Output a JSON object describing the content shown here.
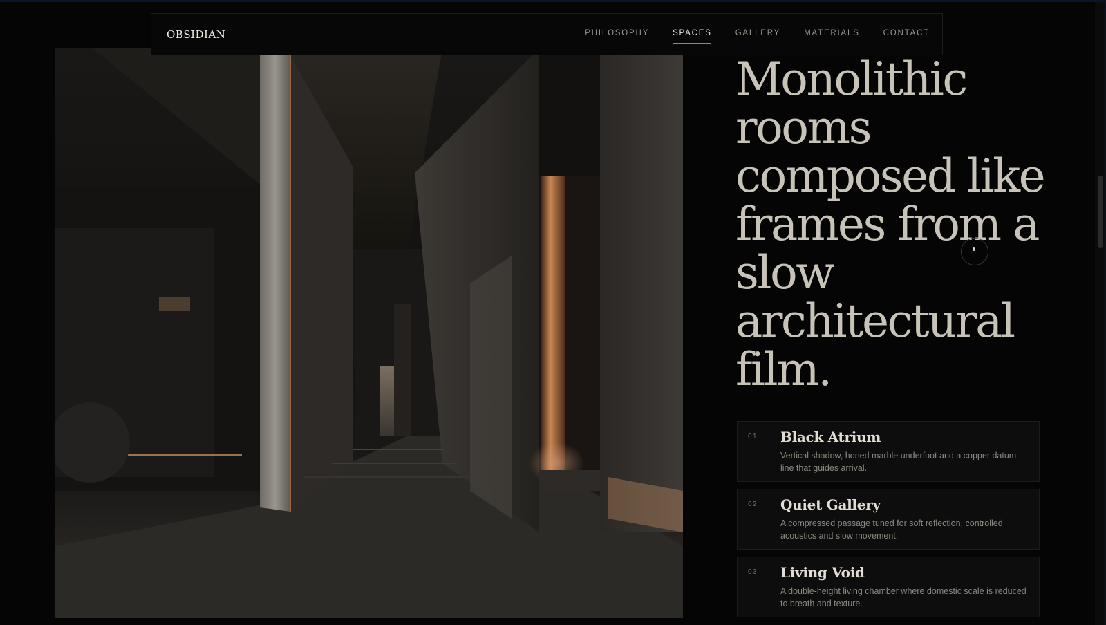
{
  "brand": {
    "name": "OBSIDIAN"
  },
  "nav": {
    "items": [
      {
        "label": "PHILOSOPHY",
        "active": false
      },
      {
        "label": "SPACES",
        "active": true
      },
      {
        "label": "GALLERY",
        "active": false
      },
      {
        "label": "MATERIALS",
        "active": false
      },
      {
        "label": "CONTACT",
        "active": false
      }
    ]
  },
  "hero": {
    "headline": "Monolithic rooms composed like frames from a slow architectural film.",
    "image": "dark-marble-corridor-interior"
  },
  "spaces": [
    {
      "number": "01",
      "title": "Black Atrium",
      "description": "Vertical shadow, honed marble underfoot and a copper datum line that guides arrival."
    },
    {
      "number": "02",
      "title": "Quiet Gallery",
      "description": "A compressed passage tuned for soft reflection, controlled acoustics and slow movement."
    },
    {
      "number": "03",
      "title": "Living Void",
      "description": "A double-height living chamber where domestic scale is reduced to breath and texture."
    }
  ],
  "colors": {
    "background": "#050505",
    "accent": "#b47a63",
    "headline": "#c8c3b8",
    "copper_light": "#c98552"
  }
}
